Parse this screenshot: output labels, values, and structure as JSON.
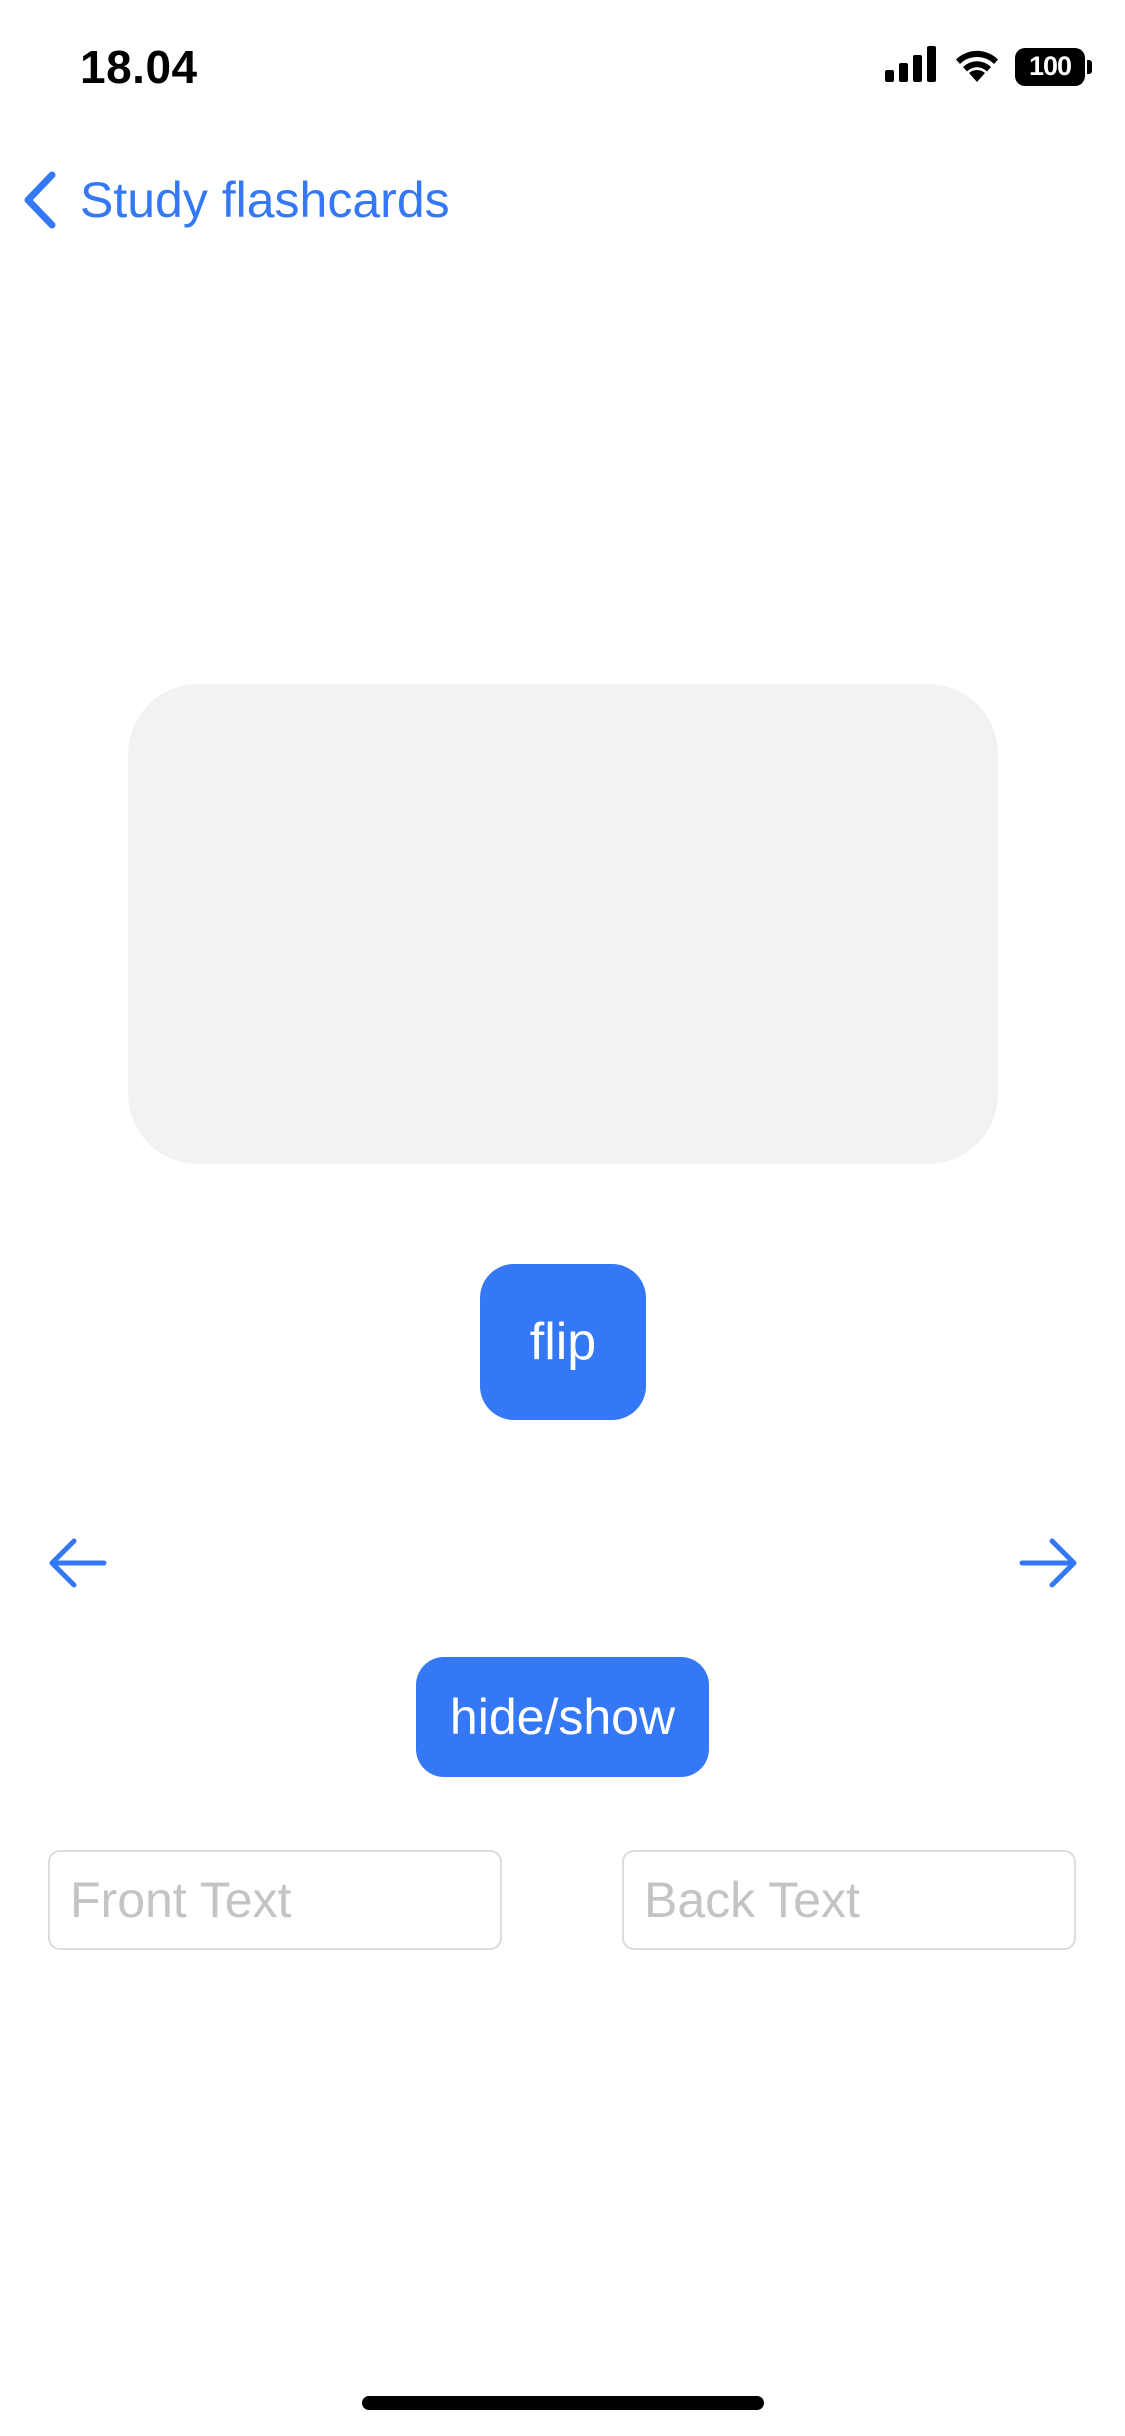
{
  "status_bar": {
    "time": "18.04",
    "battery": "100",
    "icons": [
      "signal-icon",
      "wifi-icon",
      "battery-icon"
    ]
  },
  "nav": {
    "back_label": "Study flashcards",
    "back_icon": "chevron-left-icon"
  },
  "card": {
    "text": ""
  },
  "buttons": {
    "flip_label": "flip",
    "hide_show_label": "hide/show",
    "prev_icon": "arrow-left-icon",
    "next_icon": "arrow-right-icon"
  },
  "inputs": {
    "front": {
      "value": "",
      "placeholder": "Front Text"
    },
    "back": {
      "value": "",
      "placeholder": "Back Text"
    }
  },
  "colors": {
    "accent": "#3478f6",
    "card_bg": "#f2f2f2",
    "placeholder": "#c4c4c6"
  }
}
